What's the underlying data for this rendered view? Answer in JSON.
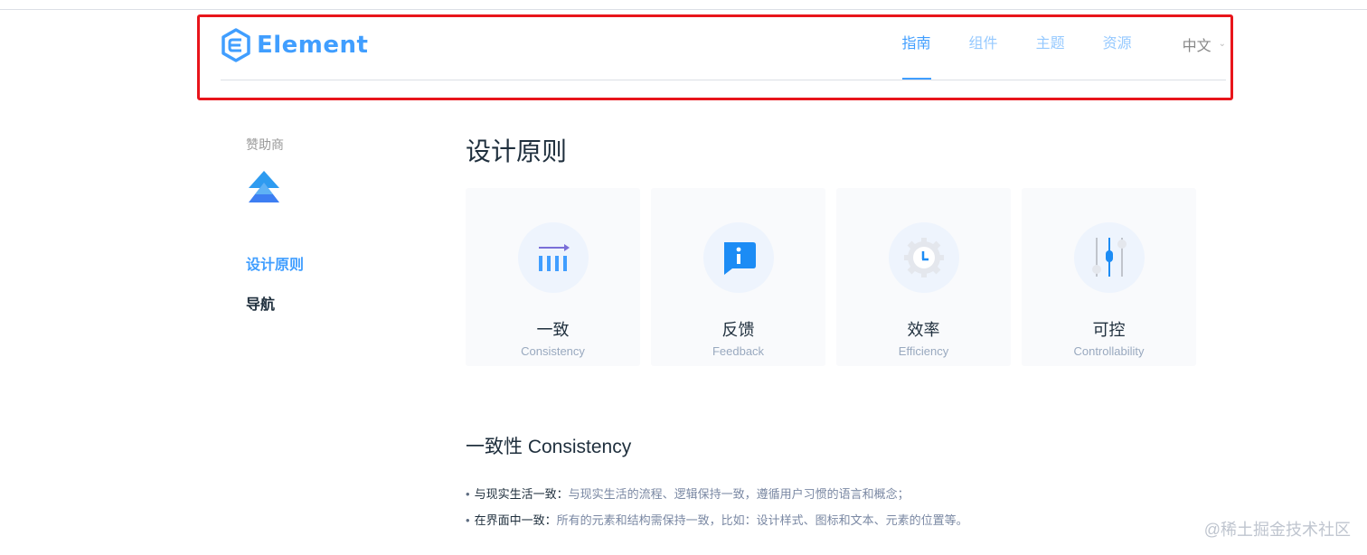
{
  "header": {
    "logo_text": "Element",
    "nav": [
      {
        "label": "指南",
        "active": true
      },
      {
        "label": "组件",
        "active": false
      },
      {
        "label": "主题",
        "active": false
      },
      {
        "label": "资源",
        "active": false
      }
    ],
    "language": "中文"
  },
  "sidebar": {
    "sponsor_label": "赞助商",
    "links": [
      {
        "label": "设计原则",
        "active": true
      },
      {
        "label": "导航",
        "active": false
      }
    ]
  },
  "main": {
    "title": "设计原则",
    "cards": [
      {
        "title": "一致",
        "subtitle": "Consistency",
        "icon": "consistency-icon"
      },
      {
        "title": "反馈",
        "subtitle": "Feedback",
        "icon": "feedback-icon"
      },
      {
        "title": "效率",
        "subtitle": "Efficiency",
        "icon": "efficiency-icon"
      },
      {
        "title": "可控",
        "subtitle": "Controllability",
        "icon": "controllability-icon"
      }
    ],
    "section_title": "一致性 Consistency",
    "bullets": [
      {
        "lead": "与现实生活一致：",
        "desc": "与现实生活的流程、逻辑保持一致，遵循用户习惯的语言和概念；"
      },
      {
        "lead": "在界面中一致：",
        "desc": "所有的元素和结构需保持一致，比如：设计样式、图标和文本、元素的位置等。"
      }
    ]
  },
  "watermark": "@稀土掘金技术社区",
  "colors": {
    "brand": "#409eff",
    "highlight": "#e8151b"
  }
}
